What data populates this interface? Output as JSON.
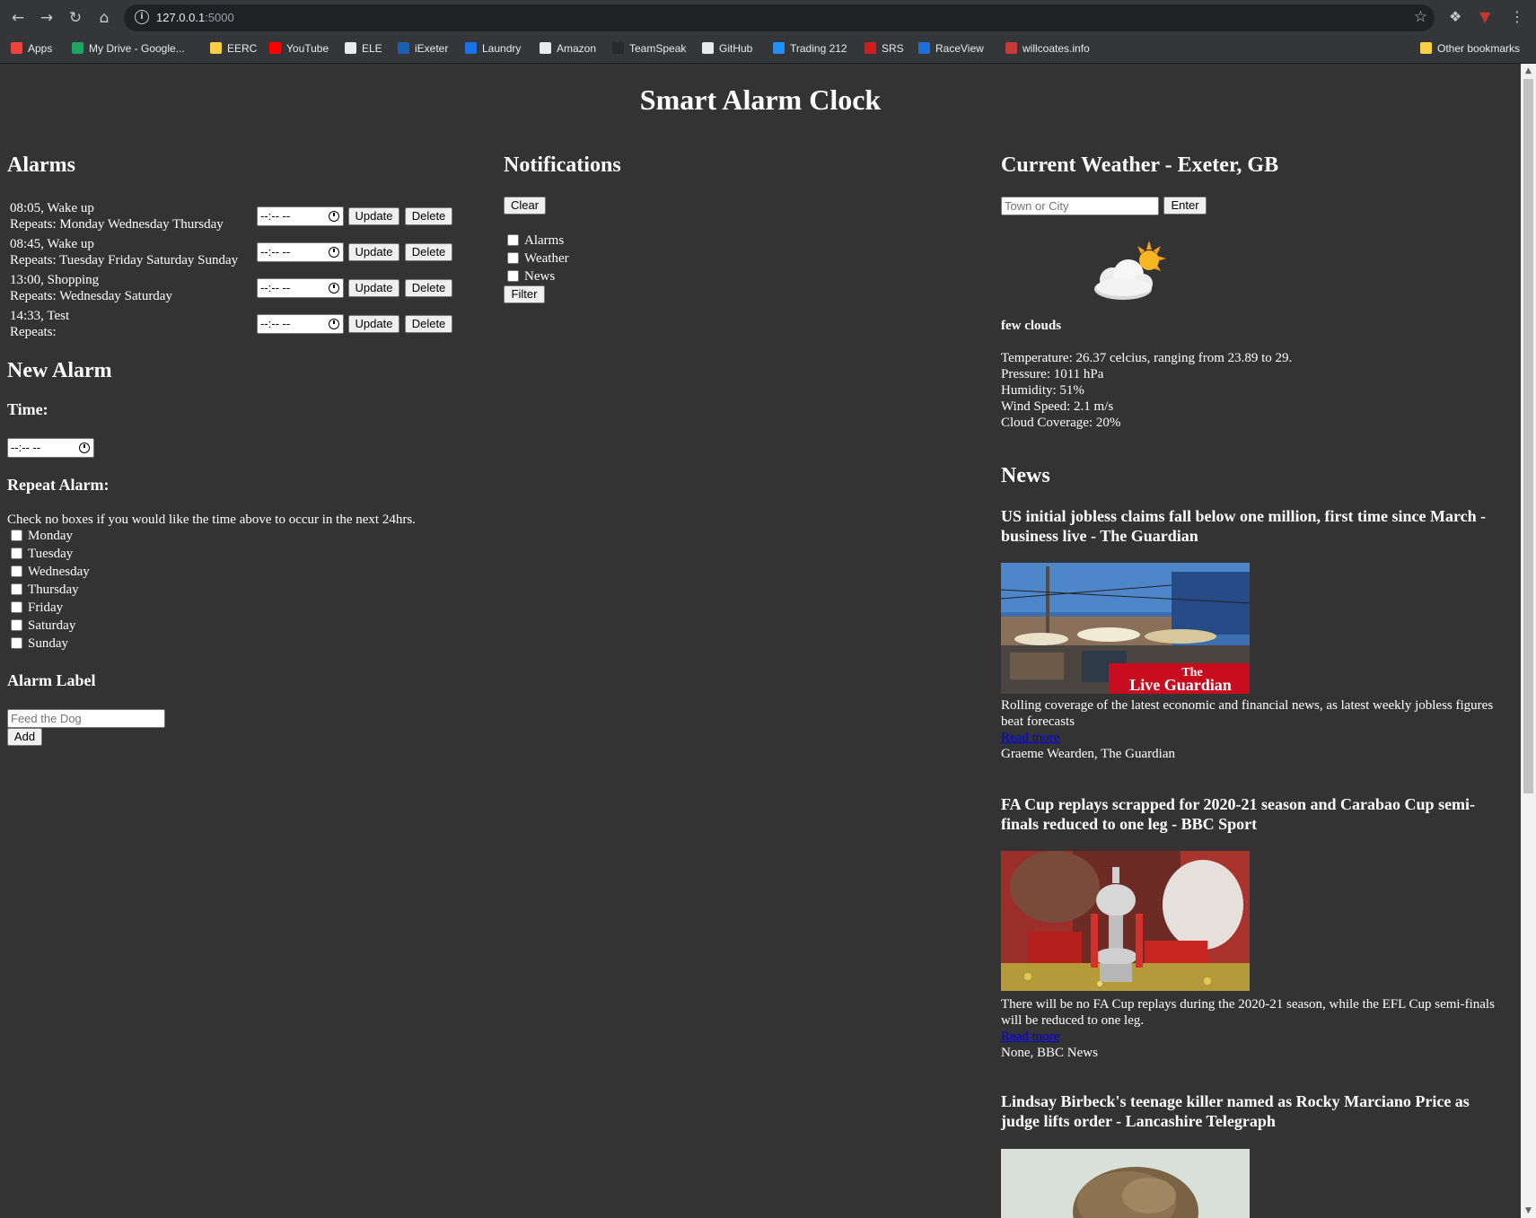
{
  "browser": {
    "url_host": "127.0.0.1",
    "url_port": ":5000",
    "bookmarks": [
      {
        "label": "Apps",
        "color": "#e8453c"
      },
      {
        "label": "My Drive - Google...",
        "color": "#1fa463"
      },
      {
        "label": "EERC",
        "color": "#f7d046"
      },
      {
        "label": "YouTube",
        "color": "#ff0000"
      },
      {
        "label": "ELE",
        "color": "#e8eaed"
      },
      {
        "label": "iExeter",
        "color": "#1a5fb4"
      },
      {
        "label": "Laundry",
        "color": "#1a73e8"
      },
      {
        "label": "Amazon",
        "color": "#e8eaed"
      },
      {
        "label": "TeamSpeak",
        "color": "#2a2a2a"
      },
      {
        "label": "GitHub",
        "color": "#e8eaed"
      },
      {
        "label": "Trading 212",
        "color": "#1e90ff"
      },
      {
        "label": "SRS",
        "color": "#d01c1c"
      },
      {
        "label": "RaceView",
        "color": "#1e6fd9"
      },
      {
        "label": "willcoates.info",
        "color": "#c43b3b"
      }
    ],
    "other_bookmarks": "Other bookmarks"
  },
  "page": {
    "title": "Smart Alarm Clock"
  },
  "alarms": {
    "heading": "Alarms",
    "update_label": "Update",
    "delete_label": "Delete",
    "time_placeholder": "--:-- --",
    "items": [
      {
        "line1": "08:05, Wake up",
        "line2": "Repeats: Monday Wednesday Thursday"
      },
      {
        "line1": "08:45, Wake up",
        "line2": "Repeats: Tuesday Friday Saturday Sunday"
      },
      {
        "line1": "13:00, Shopping",
        "line2": "Repeats: Wednesday Saturday"
      },
      {
        "line1": "14:33, Test",
        "line2": "Repeats:"
      }
    ]
  },
  "new_alarm": {
    "heading": "New Alarm",
    "time_label": "Time:",
    "time_placeholder": "--:-- --",
    "repeat_label": "Repeat Alarm:",
    "repeat_hint": "Check no boxes if you would like the time above to occur in the next 24hrs.",
    "days": [
      "Monday",
      "Tuesday",
      "Wednesday",
      "Thursday",
      "Friday",
      "Saturday",
      "Sunday"
    ],
    "label_heading": "Alarm Label",
    "label_placeholder": "Feed the Dog",
    "add_label": "Add"
  },
  "notifications": {
    "heading": "Notifications",
    "clear_label": "Clear",
    "filters": [
      "Alarms",
      "Weather",
      "News"
    ],
    "filter_label": "Filter"
  },
  "weather": {
    "heading": "Current Weather - Exeter, GB",
    "city_placeholder": "Town or City",
    "enter_label": "Enter",
    "icon": "few-clouds-day-icon",
    "description": "few clouds",
    "temperature": "Temperature: 26.37 celcius, ranging from 23.89 to 29.",
    "pressure": "Pressure: 1011 hPa",
    "humidity": "Humidity: 51%",
    "wind": "Wind Speed: 2.1 m/s",
    "cloud": "Cloud Coverage: 20%"
  },
  "news": {
    "heading": "News",
    "items": [
      {
        "title": "US initial jobless claims fall below one million, first time since March - business live - The Guardian",
        "image_badge_line1": "The",
        "image_badge_line2": "Live Guardian",
        "description": "Rolling coverage of the latest economic and financial news, as latest weekly jobless figures beat forecasts",
        "link": "Read more",
        "source": "Graeme Wearden, The Guardian"
      },
      {
        "title": "FA Cup replays scrapped for 2020-21 season and Carabao Cup semi-finals reduced to one leg - BBC Sport",
        "description": "There will be no FA Cup replays during the 2020-21 season, while the EFL Cup semi-finals will be reduced to one leg.",
        "link": "Read more",
        "source": "None, BBC News"
      },
      {
        "title": "Lindsay Birbeck's teenage killer named as Rocky Marciano Price as judge lifts order - Lancashire Telegraph"
      }
    ]
  }
}
